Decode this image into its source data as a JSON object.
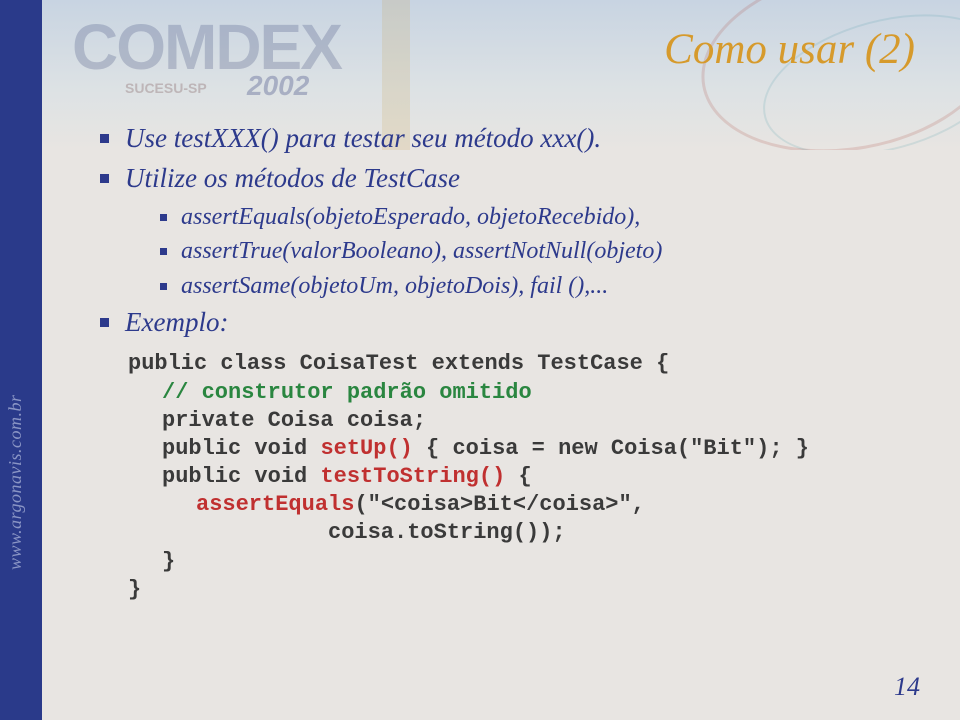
{
  "watermark": {
    "logo": "COMDEX",
    "subtitle": "SUCESU-SP",
    "year": "2002"
  },
  "title": "Como usar (2)",
  "bullets": {
    "b1": "Use testXXX() para testar seu método xxx().",
    "b2": "Utilize os métodos de TestCase",
    "sub1": "assertEquals(objetoEsperado, objetoRecebido),",
    "sub2": "assertTrue(valorBooleano), assertNotNull(objeto)",
    "sub3": "assertSame(objetoUm, objetoDois), fail (),...",
    "b3": "Exemplo:"
  },
  "code": {
    "l1a": "public class CoisaTest extends TestCase {",
    "l2a": "// construtor padrão omitido",
    "l3a": "private Coisa coisa;",
    "l4a": "public void ",
    "l4b": "setUp()",
    "l4c": " { coisa = new Coisa(\"Bit\"); }",
    "l5a": "public void ",
    "l5b": "testToString()",
    "l5c": " {",
    "l6a": "assertEquals",
    "l6b": "(\"<coisa>Bit</coisa>\",",
    "l7a": "coisa.toString());",
    "l8": "}",
    "l9": "}"
  },
  "side_url": "www.argonavis.com.br",
  "page_number": "14"
}
